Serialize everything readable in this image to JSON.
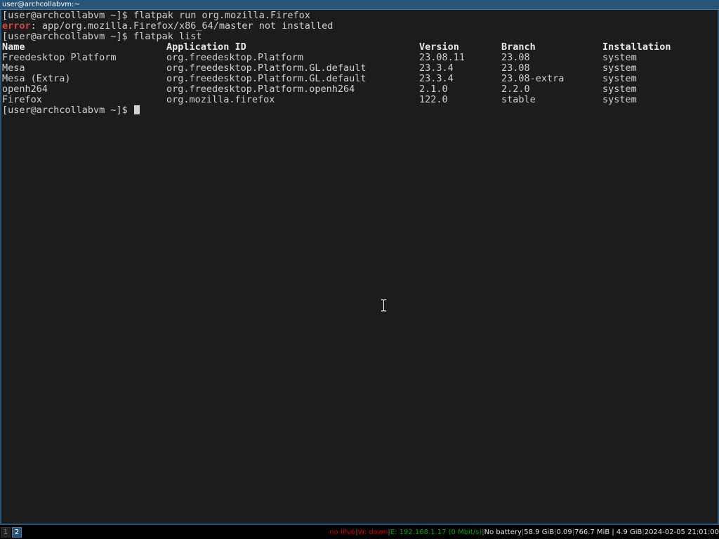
{
  "window": {
    "title": "user@archcollabvm:~"
  },
  "terminal": {
    "prompt": "[user@archcollabvm ~]$ ",
    "command1": "flatpak run org.mozilla.Firefox",
    "error_label": "error",
    "error_message": ": app/org.mozilla.Firefox/x86_64/master not installed",
    "command2": "flatpak list",
    "table": {
      "headers": [
        "Name",
        "Application ID",
        "Version",
        "Branch",
        "Installation"
      ],
      "rows": [
        [
          "Freedesktop Platform",
          "org.freedesktop.Platform",
          "23.08.11",
          "23.08",
          "system"
        ],
        [
          "Mesa",
          "org.freedesktop.Platform.GL.default",
          "23.3.4",
          "23.08",
          "system"
        ],
        [
          "Mesa (Extra)",
          "org.freedesktop.Platform.GL.default",
          "23.3.4",
          "23.08-extra",
          "system"
        ],
        [
          "openh264",
          "org.freedesktop.Platform.openh264",
          "2.1.0",
          "2.2.0",
          "system"
        ],
        [
          "Firefox",
          "org.mozilla.firefox",
          "122.0",
          "stable",
          "system"
        ]
      ]
    },
    "final_prompt": "[user@archcollabvm ~]$ "
  },
  "statusbar": {
    "workspaces": [
      "1",
      "2"
    ],
    "focused_workspace": "2",
    "ipv6": "no IPv6",
    "wireless": "W: down",
    "ethernet": "E: 192.168.1.17 (0 Mbit/s)",
    "battery": "No battery",
    "disk": "58.9 GiB",
    "load": "0.09",
    "memory": "766.7 MiB | 4.9 GiB",
    "datetime": "2024-02-05 21:01:00"
  },
  "colors": {
    "terminal_bg": "#1c1c1c",
    "titlebar_bg": "#285577",
    "text": "#d0d0d0",
    "error": "#d0473e",
    "status_red": "#cc0000",
    "status_green": "#00aa00"
  }
}
